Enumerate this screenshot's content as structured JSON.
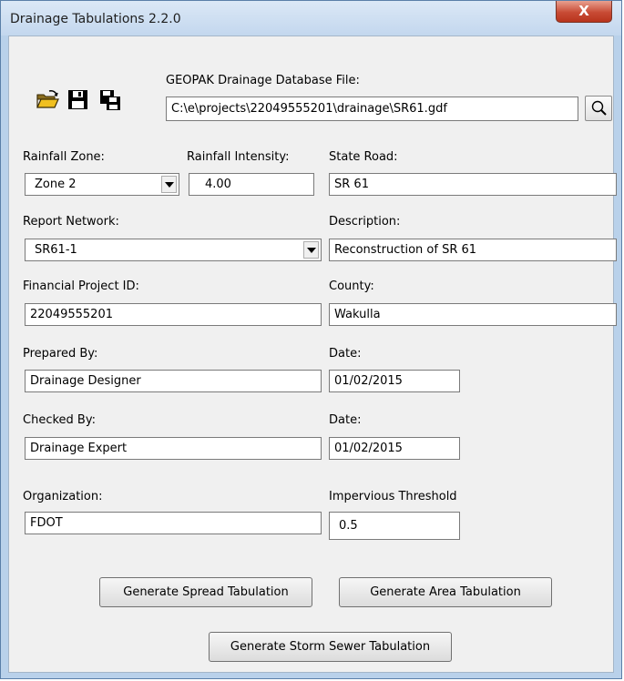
{
  "window": {
    "title": "Drainage Tabulations 2.2.0",
    "close_label": "X"
  },
  "toolbar": {
    "open_icon": "folder-open-icon",
    "save_icon": "save-floppy-icon",
    "saveall_icon": "save-all-icon"
  },
  "database": {
    "label": "GEOPAK Drainage Database File:",
    "path": "C:\\e\\projects\\22049555201\\drainage\\SR61.gdf",
    "browse_icon": "magnifier-icon"
  },
  "rainfall_zone": {
    "label": "Rainfall Zone:",
    "value": "Zone 2"
  },
  "rainfall_intensity": {
    "label": "Rainfall Intensity:",
    "value": "4.00"
  },
  "state_road": {
    "label": "State Road:",
    "value": "SR 61"
  },
  "report_network": {
    "label": "Report Network:",
    "value": "SR61-1"
  },
  "description": {
    "label": "Description:",
    "value": "Reconstruction of SR 61"
  },
  "financial_project_id": {
    "label": "Financial Project ID:",
    "value": "22049555201"
  },
  "county": {
    "label": "County:",
    "value": "Wakulla"
  },
  "prepared_by": {
    "label": "Prepared By:",
    "value": "Drainage Designer"
  },
  "prepared_date": {
    "label": "Date:",
    "value": "01/02/2015"
  },
  "checked_by": {
    "label": "Checked By:",
    "value": "Drainage Expert"
  },
  "checked_date": {
    "label": "Date:",
    "value": "01/02/2015"
  },
  "organization": {
    "label": "Organization:",
    "value": "FDOT"
  },
  "impervious_threshold": {
    "label": "Impervious Threshold",
    "value": "0.5"
  },
  "buttons": {
    "spread": "Generate Spread Tabulation",
    "area": "Generate Area Tabulation",
    "storm_sewer": "Generate Storm Sewer Tabulation"
  }
}
